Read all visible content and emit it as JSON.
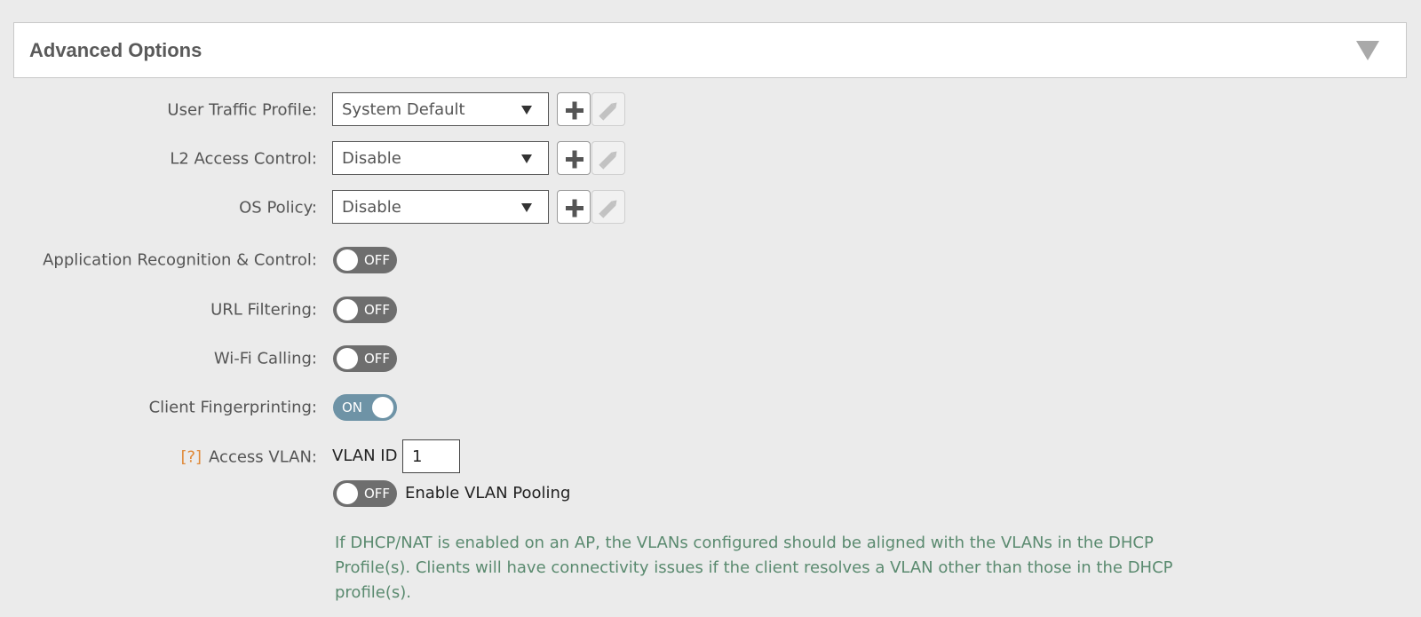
{
  "panel": {
    "title": "Advanced Options"
  },
  "fields": {
    "user_traffic_profile": {
      "label": "User Traffic Profile:",
      "value": "System Default"
    },
    "l2_access_control": {
      "label": "L2 Access Control:",
      "value": "Disable"
    },
    "os_policy": {
      "label": "OS Policy:",
      "value": "Disable"
    },
    "app_recognition": {
      "label": "Application Recognition & Control:",
      "state": "OFF"
    },
    "url_filtering": {
      "label": "URL Filtering:",
      "state": "OFF"
    },
    "wifi_calling": {
      "label": "Wi-Fi Calling:",
      "state": "OFF"
    },
    "client_fingerprinting": {
      "label": "Client Fingerprinting:",
      "state": "ON"
    },
    "access_vlan": {
      "help": "[?]",
      "label": "Access VLAN:",
      "vlan_id_label": "VLAN ID",
      "vlan_id_value": "1",
      "pooling_state": "OFF",
      "pooling_label": "Enable VLAN Pooling"
    }
  },
  "info_message": "If DHCP/NAT is enabled on an AP, the VLANs configured should be aligned with the VLANs in the DHCP Profile(s). Clients will have connectivity issues if the client resolves a VLAN other than those in the DHCP profile(s).",
  "colors": {
    "background": "#ebebeb",
    "toggle_off": "#6e6e6e",
    "toggle_on": "#6e93a6",
    "help_mark": "#e08a3a",
    "info_text": "#5a8a6f"
  }
}
